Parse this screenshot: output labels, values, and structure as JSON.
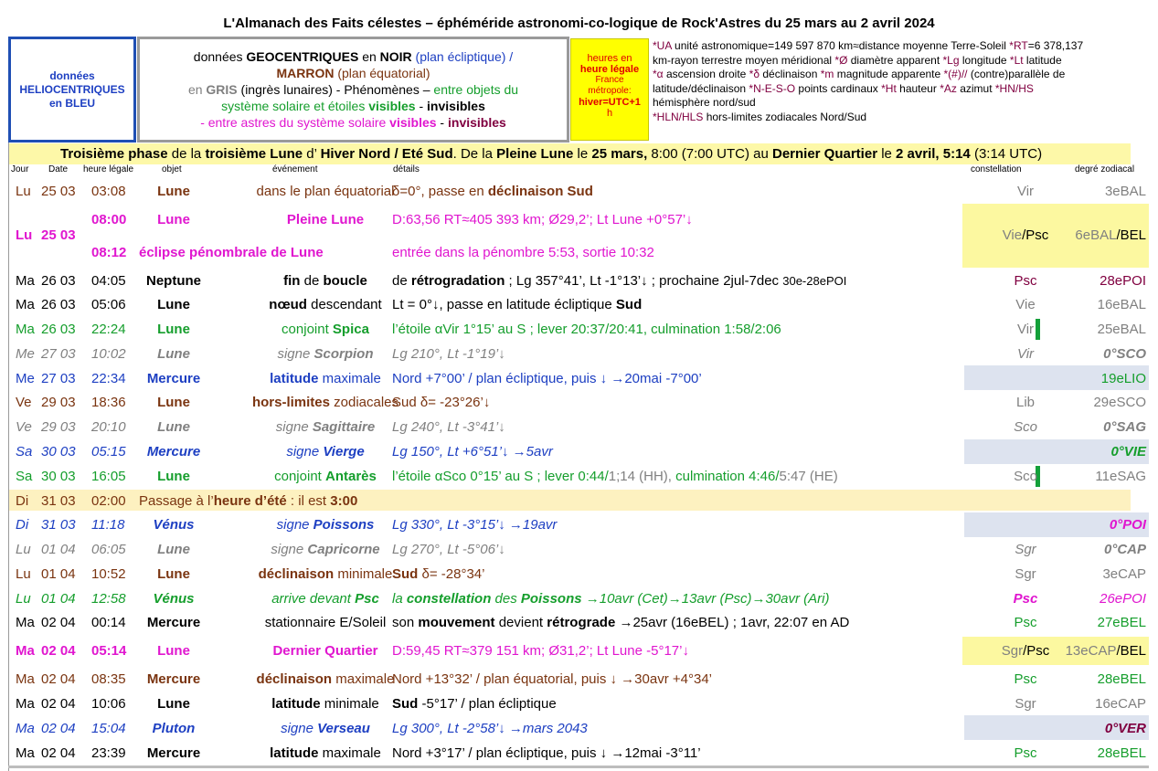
{
  "title": "L'Almanach des Faits célestes – éphéméride astronomi-co-logique de Rock'Astres du 25 mars au 2 avril 2024",
  "legend": {
    "helio_1": "données",
    "helio_2": "HELIOCENTRIQUES",
    "helio_3": "en BLEU",
    "main_1a": "données ",
    "main_1b": "GEOCENTRIQUES",
    "main_1c": " en ",
    "main_1d": "NOIR",
    "main_1e": " (plan écliptique)  /",
    "main_2a": "MARRON",
    "main_2b": " (plan équatorial)",
    "main_3a": "en ",
    "main_3b": "GRIS",
    "main_3c": " (ingrès lunaires)  -  Phénomènes – ",
    "main_3d": "entre objets du",
    "main_4a": "système solaire et étoiles ",
    "main_4b": "visibles",
    "main_4c": " - ",
    "main_4d": "invisibles",
    "main_5a": "- entre astres du système solaire ",
    "main_5b": "visibles",
    "main_5c": " - ",
    "main_5d": "invisibles",
    "time_1": "heures en",
    "time_2": "heure légale",
    "time_3": "France",
    "time_4": "métropole:",
    "time_5": "hiver=UTC+1",
    "time_6": "h",
    "abbr_1a": "*UA",
    "abbr_1b": " unité astronomique=149 597 870 km≈distance moyenne Terre-Soleil   ",
    "abbr_1c": "*RT",
    "abbr_1d": "=6 378,137",
    "abbr_2a": "km-rayon terrestre moyen méridional   ",
    "abbr_2b": "*Ø",
    "abbr_2c": " diamètre apparent  ",
    "abbr_2d": "*Lg",
    "abbr_2e": " longitude  ",
    "abbr_2f": "*Lt",
    "abbr_2g": " latitude",
    "abbr_3a": "*α",
    "abbr_3b": " ascension droite ",
    "abbr_3c": "*δ",
    "abbr_3d": " déclinaison  ",
    "abbr_3e": "*m",
    "abbr_3f": " magnitude apparente   ",
    "abbr_3g": "*(#)//",
    "abbr_3h": " (contre)parallèle de",
    "abbr_4a": "latitude/déclinaison  ",
    "abbr_4b": "*N-E-S-O",
    "abbr_4c": " points cardinaux  ",
    "abbr_4d": "*Ht",
    "abbr_4e": " hauteur  ",
    "abbr_4f": "*Az",
    "abbr_4g": " azimut   ",
    "abbr_4h": "*HN/HS",
    "abbr_5": "hémisphère nord/sud",
    "abbr_6a": "*HLN/HLS",
    "abbr_6b": " hors-limites zodiacales Nord/Sud"
  },
  "phase": {
    "p1": "Troisième phase",
    "p2": " de la ",
    "p3": "troisième Lune",
    "p4": " d’ ",
    "p5": "Hiver Nord / Eté Sud",
    "p6": ". De la ",
    "p7": "Pleine Lune",
    "p8": " le ",
    "p9": "25 mars,",
    "p10": " 8:00 (7:00 UTC) au ",
    "p11": "Dernier Quartier",
    "p12": " le ",
    "p13": "2 avril, 5:14",
    "p14": " (3:14 UTC)"
  },
  "headers": {
    "day": "Jour",
    "date": "Date",
    "time": "heure légale",
    "object": "objet",
    "event": "événement",
    "details": "détails",
    "constellation": "constellation",
    "degree": "degré zodiacal"
  },
  "rows": {
    "r1": {
      "day": "Lu",
      "date": "25 03",
      "time": "03:08",
      "obj": "Lune",
      "event": "dans le plan équatorial",
      "details_a": "δ=0°, passe en ",
      "details_b": "déclinaison Sud",
      "const": "Vir",
      "deg": "3eBAL"
    },
    "r2": {
      "day": "Lu",
      "date": "25 03",
      "time_a": "08:00",
      "obj": "Lune",
      "event_a": "Pleine Lune",
      "details_a": "D:63,56 RT≈405 393 km; Ø29,2’; Lt Lune +0°57’↓",
      "time_b": "08:12",
      "event_b": "éclipse pénombrale de Lune",
      "details_b": "entrée dans la pénombre 5:53, sortie 10:32",
      "const_a": "Vie",
      "const_b": "/Psc",
      "deg_a": "6eBAL",
      "deg_b": "/BEL"
    },
    "r3": {
      "day": "Ma",
      "date": "26 03",
      "time": "04:05",
      "obj": "Neptune",
      "event_a": "fin",
      "event_b": " de ",
      "event_c": "boucle",
      "details_a": "de ",
      "details_b": "rétrogradation",
      "details_c": " ; Lg 357°41’, Lt -1°13’↓ ; prochaine 2jul-7dec ",
      "details_d": "30e-28ePOI",
      "const": "Psc",
      "deg": "28ePOI"
    },
    "r4": {
      "day": "Ma",
      "date": "26 03",
      "time": "05:06",
      "obj": "Lune",
      "event_a": "nœud",
      "event_b": " descendant",
      "details_a": "Lt = 0°↓, passe en latitude écliptique ",
      "details_b": "Sud",
      "const": "Vie",
      "deg": "16eBAL"
    },
    "r5": {
      "day": "Ma",
      "date": "26 03",
      "time": "22:24",
      "obj": "Lune",
      "event_a": "conjoint ",
      "event_b": "Spica",
      "details": "l’étoile αVir 1°15’ au S ; lever 20:37/20:41, culmination 1:58/2:06",
      "const": "Vir",
      "deg": "25eBAL"
    },
    "r6": {
      "day": "Me",
      "date": "27 03",
      "time": "10:02",
      "obj": "Lune",
      "event_a": "signe ",
      "event_b": "Scorpion",
      "details": "Lg 210°, Lt -1°19’↓",
      "const": "Vir",
      "deg": "0°SCO"
    },
    "r7": {
      "day": "Me",
      "date": "27 03",
      "time": "22:34",
      "obj": "Mercure",
      "event_a": "latitude",
      "event_b": " maximale",
      "details": "Nord +7°00’ / plan écliptique, puis ↓ →20mai -7°00’",
      "const": "",
      "deg": "19eLIO"
    },
    "r8": {
      "day": "Ve",
      "date": "29 03",
      "time": "18:36",
      "obj": "Lune",
      "event_a": "hors-limites",
      "event_b": " zodiacales",
      "details": "Sud δ= -23°26’↓",
      "const": "Lib",
      "deg": "29eSCO"
    },
    "r9": {
      "day": "Ve",
      "date": "29 03",
      "time": "20:10",
      "obj": "Lune",
      "event_a": "signe ",
      "event_b": "Sagittaire",
      "details": "Lg 240°, Lt -3°41’↓",
      "const": "Sco",
      "deg": "0°SAG"
    },
    "r10": {
      "day": "Sa",
      "date": "30 03",
      "time": "05:15",
      "obj": "Mercure",
      "event_a": "signe ",
      "event_b": "Vierge",
      "details": "Lg 150°, Lt +6°51’↓ →5avr",
      "const": "",
      "deg": "0°VIE"
    },
    "r11": {
      "day": "Sa",
      "date": "30 03",
      "time": "16:05",
      "obj": "Lune",
      "event_a": "conjoint ",
      "event_b": "Antarès",
      "details_a": "l’étoile αSco 0°15’ au S ; lever 0:44/",
      "details_b": "1;14 (HH), ",
      "details_c": "culmination 4:46/",
      "details_d": "5:47 (HE)",
      "const": "Sco",
      "deg": "11eSAG"
    },
    "r12": {
      "day": "Di",
      "date": "31 03",
      "time": "02:00",
      "text_a": "Passage à l’",
      "text_b": "heure d’été",
      "text_c": " : il est ",
      "text_d": "3:00"
    },
    "r13": {
      "day": "Di",
      "date": "31 03",
      "time": "11:18",
      "obj": "Vénus",
      "event_a": "signe ",
      "event_b": "Poissons",
      "details": "Lg 330°, Lt -3°15’↓ →19avr",
      "const": "",
      "deg": "0°POI"
    },
    "r14": {
      "day": "Lu",
      "date": "01 04",
      "time": "06:05",
      "obj": "Lune",
      "event_a": "signe ",
      "event_b": "Capricorne",
      "details": "Lg 270°, Lt -5°06’↓",
      "const": "Sgr",
      "deg": "0°CAP"
    },
    "r15": {
      "day": "Lu",
      "date": "01 04",
      "time": "10:52",
      "obj": "Lune",
      "event_a": "déclinaison",
      "event_b": " minimale",
      "details_a": "Sud",
      "details_b": " δ= -28°34’",
      "const": "Sgr",
      "deg": "3eCAP"
    },
    "r16": {
      "day": "Lu",
      "date": "01 04",
      "time": "12:58",
      "obj": "Vénus",
      "event_a": "arrive devant ",
      "event_b": "Psc",
      "details_a": "la ",
      "details_b": "constellation",
      "details_c": " des ",
      "details_d": "Poissons",
      "details_e": " →10avr (Cet)→13avr (Psc)→30avr (Ari)",
      "const": "Psc",
      "deg": "26ePOI"
    },
    "r17": {
      "day": "Ma",
      "date": "02 04",
      "time": "00:14",
      "obj": "Mercure",
      "event": "stationnaire E/Soleil",
      "details_a": "son ",
      "details_b": "mouvement",
      "details_c": " devient ",
      "details_d": "rétrograde",
      "details_e": " →25avr (16eBEL) ; 1avr, 22:07 en AD",
      "const": "Psc",
      "deg": "27eBEL"
    },
    "r18": {
      "day": "Ma",
      "date": "02 04",
      "time": "05:14",
      "obj": "Lune",
      "event": "Dernier Quartier",
      "details": "D:59,45 RT≈379 151 km; Ø31,2’; Lt Lune -5°17’↓",
      "const_a": "Sgr",
      "const_b": "/Psc",
      "deg_a": "13eCAP",
      "deg_b": "/BEL"
    },
    "r19": {
      "day": "Ma",
      "date": "02 04",
      "time": "08:35",
      "obj": "Mercure",
      "event_a": "déclinaison",
      "event_b": " maximale",
      "details": "Nord +13°32’ / plan équatorial, puis ↓ →30avr +4°34’",
      "const": "Psc",
      "deg": "28eBEL"
    },
    "r20": {
      "day": "Ma",
      "date": "02 04",
      "time": "10:06",
      "obj": "Lune",
      "event_a": "latitude",
      "event_b": " minimale",
      "details_a": "Sud",
      "details_b": " -5°17’ / plan écliptique",
      "const": "Sgr",
      "deg": "16eCAP"
    },
    "r21": {
      "day": "Ma",
      "date": "02 04",
      "time": "15:04",
      "obj": "Pluton",
      "event_a": "signe ",
      "event_b": "Verseau",
      "details": "Lg 300°, Lt -2°58’↓ →mars 2043",
      "const": "",
      "deg": "0°VER"
    },
    "r22": {
      "day": "Ma",
      "date": "02 04",
      "time": "23:39",
      "obj": "Mercure",
      "event_a": "latitude",
      "event_b": " maximale",
      "details": "Nord +3°17’ / plan écliptique, puis ↓ →12mai -3°11’",
      "const": "Psc",
      "deg": "28eBEL"
    }
  },
  "colors": {
    "helio_blue": "#1d3fc2",
    "equatorial_brown": "#7a3410",
    "lunar_grey": "#808080",
    "visible_green": "#159e2c",
    "visible_magenta": "#e016cf",
    "invisible_maroon": "#800040",
    "highlight_yellow": "#fcf8a0",
    "highlight_blue": "#dde3ef"
  }
}
